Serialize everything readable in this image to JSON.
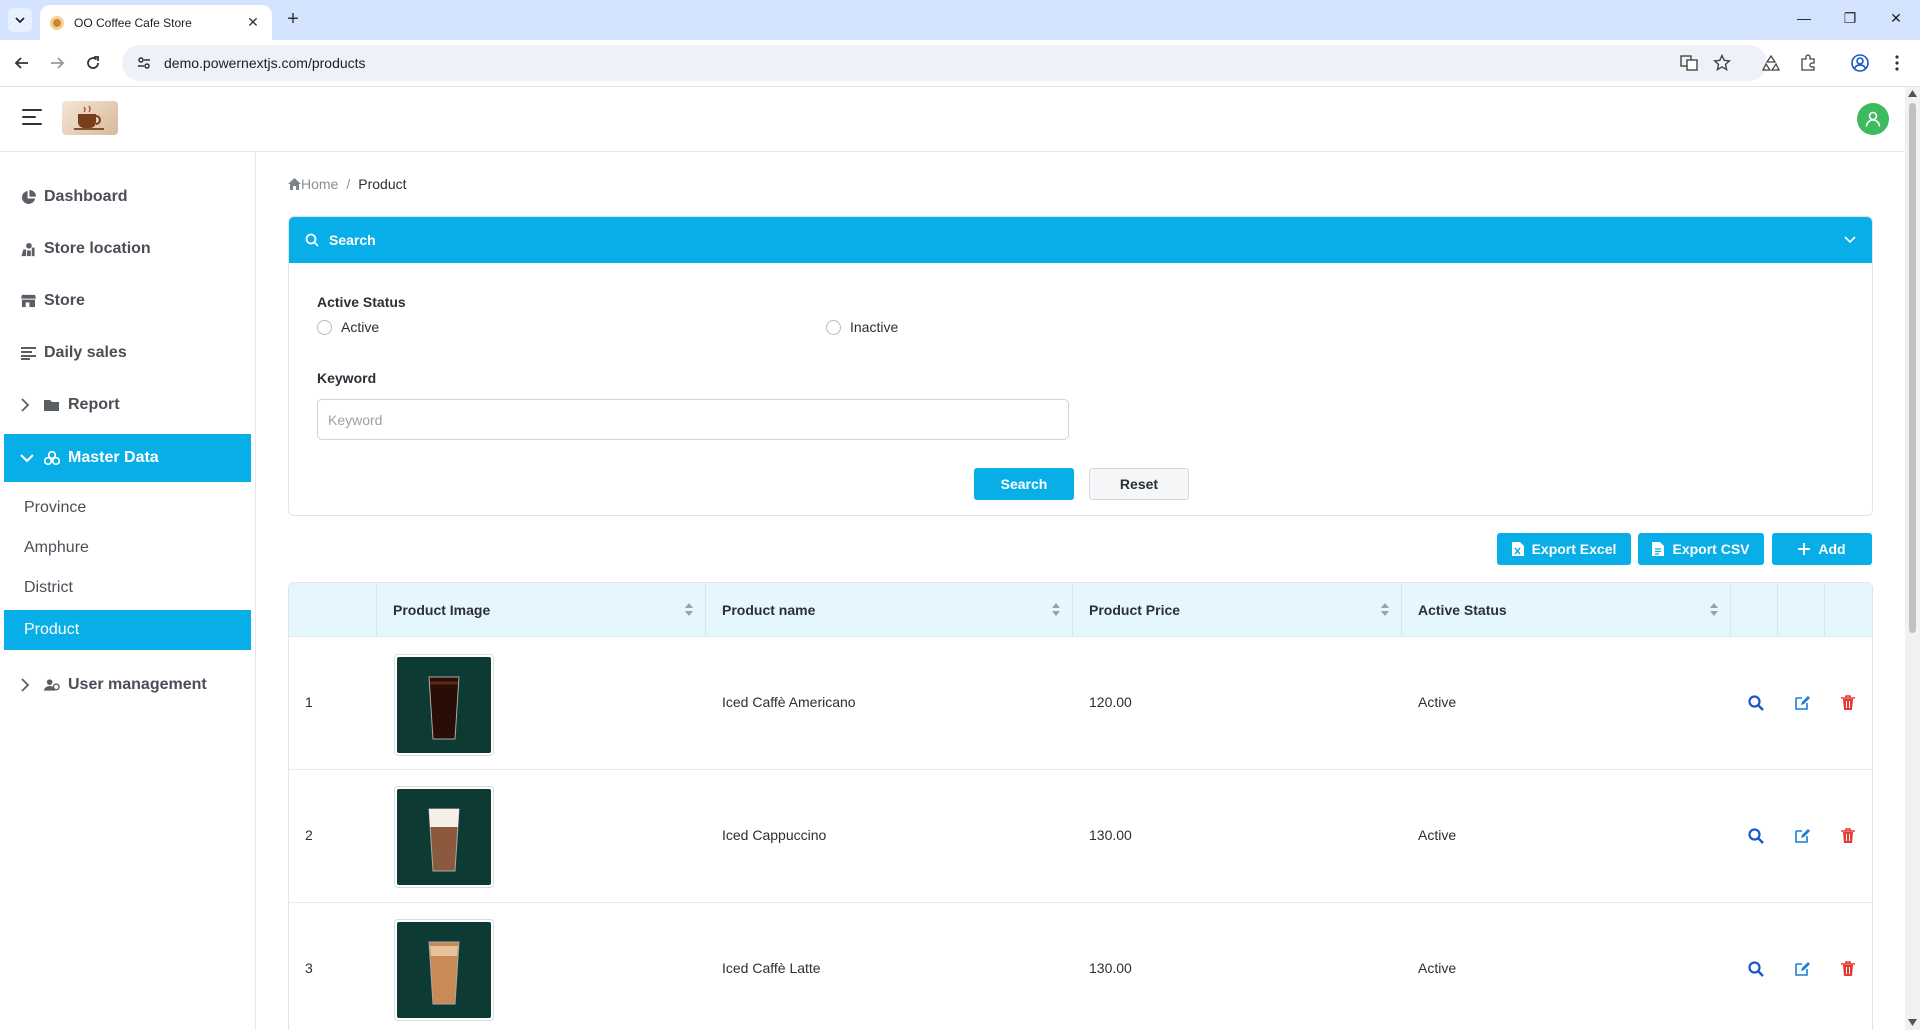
{
  "browser": {
    "tab_title": "OO Coffee Cafe Store",
    "url": "demo.powernextjs.com/products"
  },
  "sidebar": {
    "items": [
      {
        "label": "Dashboard",
        "icon": "pie-chart-icon"
      },
      {
        "label": "Store location",
        "icon": "location-icon"
      },
      {
        "label": "Store",
        "icon": "store-icon"
      },
      {
        "label": "Daily sales",
        "icon": "list-icon"
      },
      {
        "label": "Report",
        "icon": "folder-icon"
      },
      {
        "label": "Master Data",
        "icon": "database-icon"
      },
      {
        "label": "User management",
        "icon": "users-icon"
      }
    ],
    "sub_items": [
      "Province",
      "Amphure",
      "District",
      "Product"
    ]
  },
  "breadcrumb": {
    "home": "Home",
    "current": "Product"
  },
  "search_panel": {
    "title": "Search",
    "active_status_label": "Active Status",
    "radio_active": "Active",
    "radio_inactive": "Inactive",
    "keyword_label": "Keyword",
    "keyword_placeholder": "Keyword",
    "search_button": "Search",
    "reset_button": "Reset"
  },
  "actions": {
    "export_excel": "Export Excel",
    "export_csv": "Export CSV",
    "add": "Add"
  },
  "table": {
    "headers": [
      "Product Image",
      "Product name",
      "Product Price",
      "Active Status"
    ],
    "rows": [
      {
        "no": "1",
        "name": "Iced Caffè Americano",
        "price": "120.00",
        "status": "Active"
      },
      {
        "no": "2",
        "name": "Iced Cappuccino",
        "price": "130.00",
        "status": "Active"
      },
      {
        "no": "3",
        "name": "Iced Caffè Latte",
        "price": "130.00",
        "status": "Active"
      }
    ]
  },
  "colors": {
    "accent": "#08aee8",
    "avatar": "#3dbb5e",
    "delete": "#e53935",
    "thumb_bg": "#0d3b34"
  }
}
